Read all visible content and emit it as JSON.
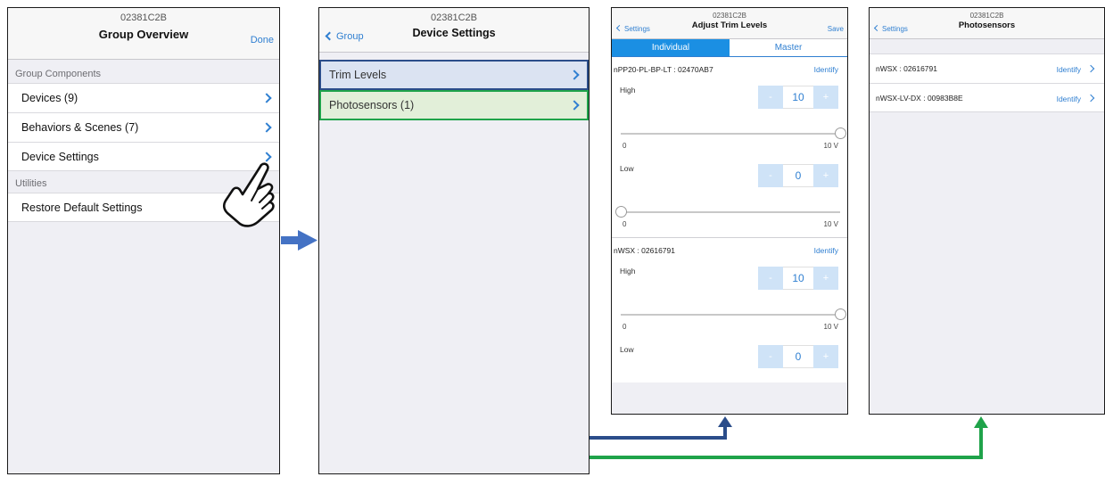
{
  "screen1": {
    "device_id": "02381C2B",
    "title": "Group Overview",
    "done_label": "Done",
    "sections": [
      {
        "header": "Group Components",
        "items": [
          "Devices (9)",
          "Behaviors & Scenes (7)",
          "Device Settings"
        ]
      },
      {
        "header": "Utilities",
        "items": [
          "Restore Default Settings"
        ]
      }
    ]
  },
  "screen2": {
    "device_id": "02381C2B",
    "title": "Device Settings",
    "back_label": "Group",
    "items": [
      "Trim Levels",
      "Photosensors (1)"
    ]
  },
  "screen3": {
    "device_id": "02381C2B",
    "title": "Adjust Trim Levels",
    "back_label": "Settings",
    "save_label": "Save",
    "tabs": [
      "Individual",
      "Master"
    ],
    "active_tab": "Individual",
    "identify_label": "Identify",
    "devices": [
      {
        "name": "nPP20-PL-BP-LT : 02470AB7",
        "levels": [
          {
            "label": "High",
            "value": "10",
            "min": "0",
            "max": "10 V",
            "fraction": 1.0
          },
          {
            "label": "Low",
            "value": "0",
            "min": "0",
            "max": "10 V",
            "fraction": 0.0
          }
        ]
      },
      {
        "name": "nWSX : 02616791",
        "levels": [
          {
            "label": "High",
            "value": "10",
            "min": "0",
            "max": "10 V",
            "fraction": 1.0
          },
          {
            "label": "Low",
            "value": "0",
            "min": "",
            "max": "",
            "fraction": 0.0
          }
        ]
      }
    ],
    "stepper_minus": "-",
    "stepper_plus": "+"
  },
  "screen4": {
    "device_id": "02381C2B",
    "title": "Photosensors",
    "back_label": "Settings",
    "identify_label": "Identify",
    "items": [
      "nWSX : 02616791",
      "nWSX-LV-DX : 00983B8E"
    ]
  },
  "colors": {
    "ios_blue": "#2f7fd1",
    "flow_blue": "#4472c4",
    "flow_navy": "#2b4d8a",
    "flow_green": "#1fa34a",
    "trim_highlight": "#dbe3f2",
    "photo_highlight": "#e2efd9"
  },
  "icons": [
    "hand-pointer-icon",
    "chevron-right-icon",
    "chevron-left-icon",
    "flow-arrow-icon"
  ]
}
